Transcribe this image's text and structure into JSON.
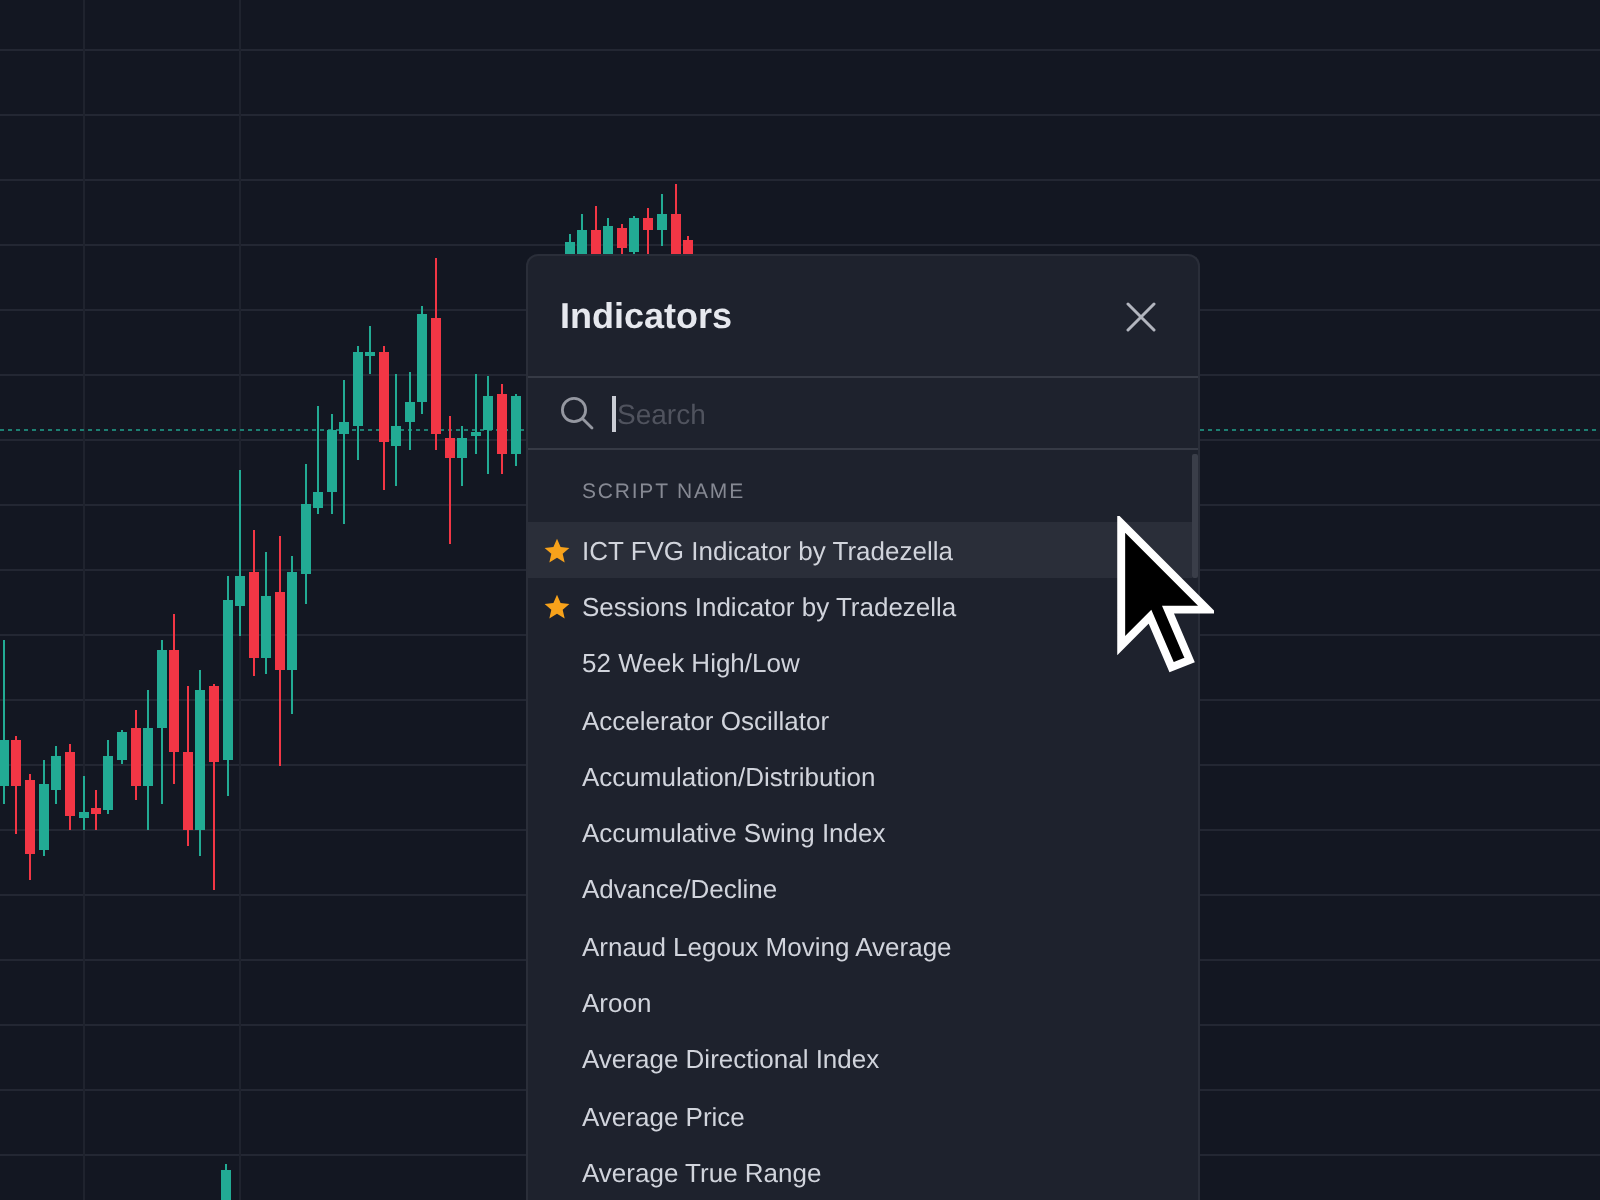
{
  "dialog": {
    "title": "Indicators",
    "search": {
      "placeholder": "Search"
    },
    "list": {
      "column_header": "SCRIPT NAME",
      "items": [
        {
          "label": "ICT FVG Indicator by Tradezella",
          "starred": true,
          "selected": true
        },
        {
          "label": "Sessions Indicator by Tradezella",
          "starred": true,
          "selected": false
        },
        {
          "label": "52 Week High/Low",
          "starred": false,
          "selected": false
        },
        {
          "label": "Accelerator Oscillator",
          "starred": false,
          "selected": false
        },
        {
          "label": "Accumulation/Distribution",
          "starred": false,
          "selected": false
        },
        {
          "label": "Accumulative Swing Index",
          "starred": false,
          "selected": false
        },
        {
          "label": "Advance/Decline",
          "starred": false,
          "selected": false
        },
        {
          "label": "Arnaud Legoux Moving Average",
          "starred": false,
          "selected": false
        },
        {
          "label": "Aroon",
          "starred": false,
          "selected": false
        },
        {
          "label": "Average Directional Index",
          "starred": false,
          "selected": false
        },
        {
          "label": "Average Price",
          "starred": false,
          "selected": false
        },
        {
          "label": "Average True Range",
          "starred": false,
          "selected": false
        }
      ]
    }
  }
}
